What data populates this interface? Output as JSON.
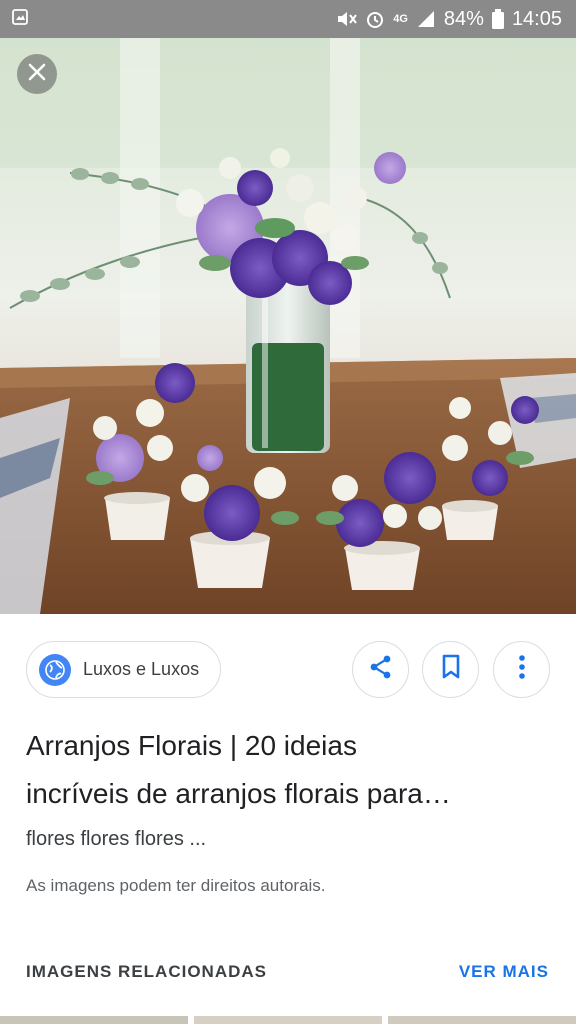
{
  "status_bar": {
    "network": "4G",
    "battery": "84%",
    "time": "14:05"
  },
  "image": {
    "subject": "flower arrangements in vase and small white pots"
  },
  "source": {
    "name": "Luxos e Luxos"
  },
  "title": {
    "line1": "Arranjos Florais | 20 ideias",
    "line2": "incríveis de arranjos florais para…"
  },
  "subtitle": "flores flores flores ...",
  "copyright": "As imagens podem ter direitos autorais.",
  "related": {
    "label": "IMAGENS RELACIONADAS",
    "see_more": "VER MAIS"
  },
  "colors": {
    "accent": "#1a73e8",
    "globe": "#4285f4",
    "status_bar": "#8a8a8a"
  }
}
